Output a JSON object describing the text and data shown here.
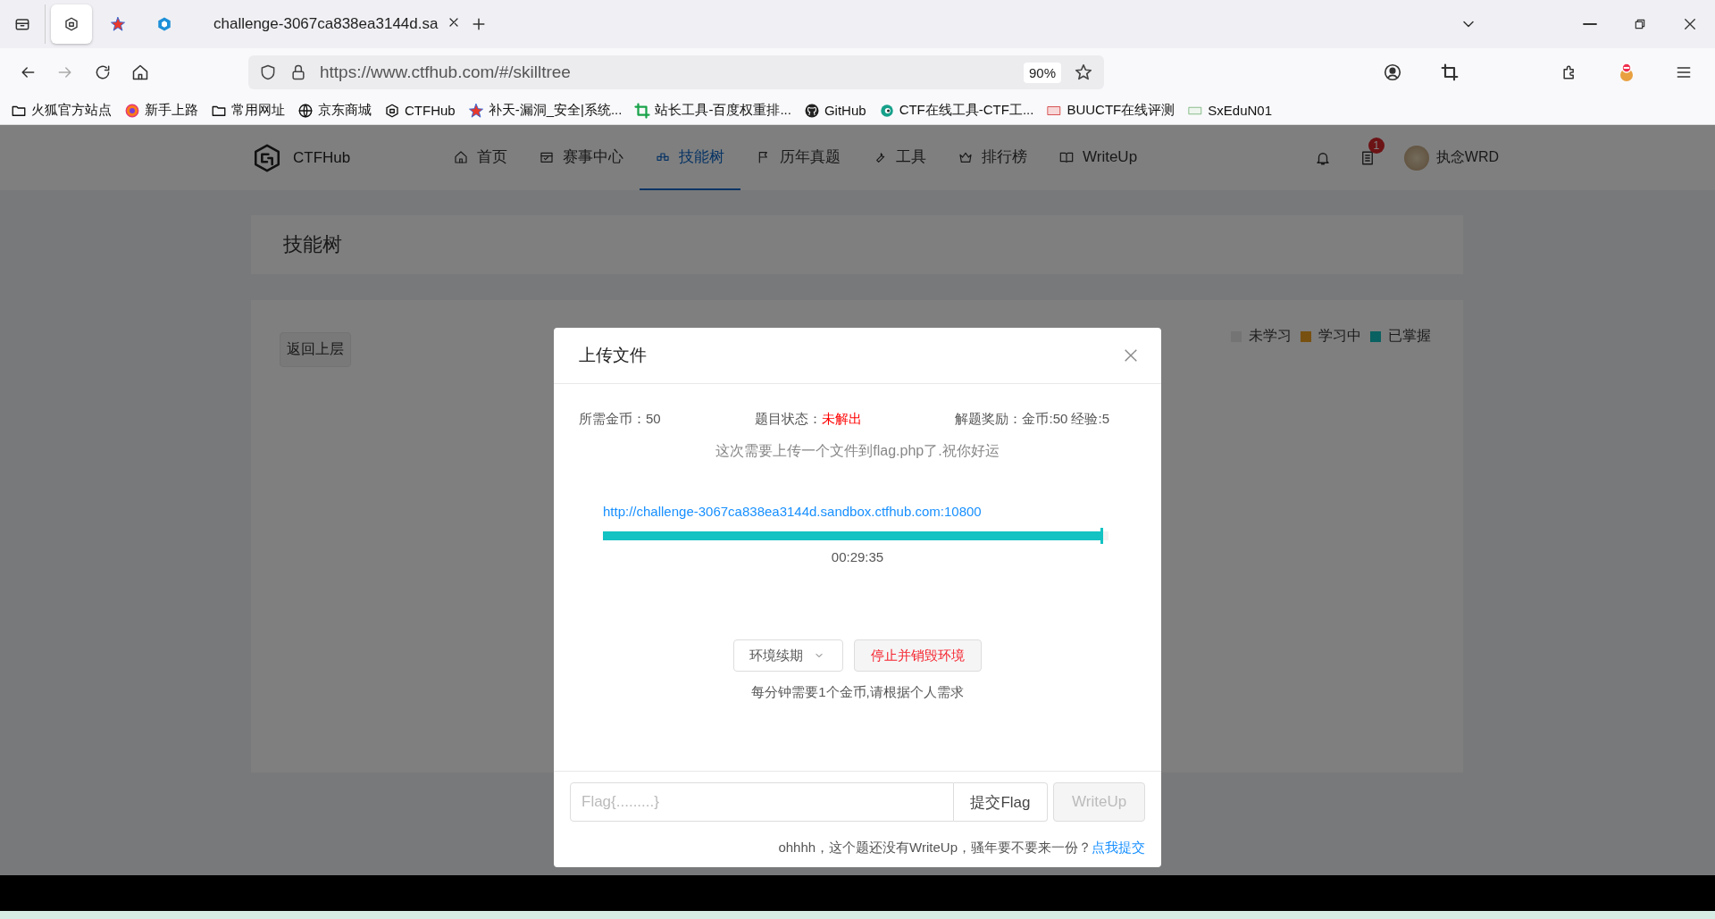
{
  "browser": {
    "tabs": [
      {
        "kind": "hub",
        "selected": true
      },
      {
        "kind": "star",
        "selected": false
      },
      {
        "kind": "cube",
        "selected": false
      },
      {
        "kind": "page",
        "title": "challenge-3067ca838ea3144d.sa",
        "selected": false
      }
    ],
    "url": "https://www.ctfhub.com/#/skilltree",
    "zoom": "90%",
    "bookmarks": [
      {
        "kind": "folder",
        "label": "火狐官方站点"
      },
      {
        "kind": "firefox",
        "label": "新手上路"
      },
      {
        "kind": "folder",
        "label": "常用网址"
      },
      {
        "kind": "globe",
        "label": "京东商城"
      },
      {
        "kind": "hub",
        "label": "CTFHub"
      },
      {
        "kind": "star",
        "label": "补天-漏洞_安全|系统..."
      },
      {
        "kind": "crop",
        "label": "站长工具-百度权重排..."
      },
      {
        "kind": "github",
        "label": "GitHub"
      },
      {
        "kind": "eye",
        "label": "CTF在线工具-CTF工..."
      },
      {
        "kind": "buu",
        "label": "BUUCTF在线评测"
      },
      {
        "kind": "sx",
        "label": "SxEduN01"
      }
    ]
  },
  "site": {
    "logo": "CTFHub",
    "nav": [
      {
        "label": "首页",
        "selected": false
      },
      {
        "label": "赛事中心",
        "selected": false
      },
      {
        "label": "技能树",
        "selected": true
      },
      {
        "label": "历年真题",
        "selected": false
      },
      {
        "label": "工具",
        "selected": false
      },
      {
        "label": "排行榜",
        "selected": false
      },
      {
        "label": "WriteUp",
        "selected": false
      }
    ],
    "badge": "1",
    "user": "执念WRD"
  },
  "page_title": "技能树",
  "back_button": "返回上层",
  "legend": [
    {
      "label": "未学习",
      "color": "#747474"
    },
    {
      "label": "学习中",
      "color": "#785010"
    },
    {
      "label": "已掌握",
      "color": "#0a6161"
    }
  ],
  "modal": {
    "title": "上传文件",
    "info": [
      {
        "kind": "plain",
        "label": "所需金币：",
        "value": "50"
      },
      {
        "kind": "alert",
        "label": "题目状态：",
        "value": "未解出"
      },
      {
        "kind": "plain",
        "label": "解题奖励：",
        "value": "金币:50 经验:5"
      }
    ],
    "description": "这次需要上传一个文件到flag.php了.祝你好运",
    "link": "http://challenge-3067ca838ea3144d.sandbox.ctfhub.com:10800",
    "progress": {
      "level": 0.99,
      "time": "00:29:35"
    },
    "renew_button": "环境续期",
    "destroy_button": "停止并销毁环境",
    "hint": "每分钟需要1个金币,请根据个人需求",
    "flag_field": {
      "placeholder": "Flag{.........}"
    },
    "submit_button": "提交Flag",
    "writeup_button": {
      "label": "WriteUp",
      "disabled": true
    },
    "footer_text": "ohhhh，这个题还没有WriteUp，骚年要不要来一份？",
    "footer_link": "点我提交"
  }
}
